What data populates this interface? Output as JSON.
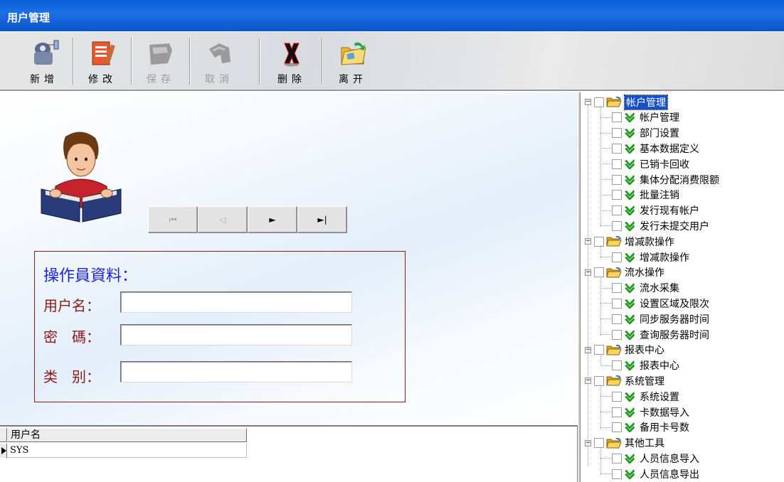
{
  "window": {
    "title": "用户管理"
  },
  "toolbar": {
    "buttons": [
      {
        "label": "新增",
        "icon": "new-user-icon",
        "enabled": true
      },
      {
        "label": "修改",
        "icon": "edit-form-icon",
        "enabled": true
      },
      {
        "label": "保存",
        "icon": "save-icon",
        "enabled": false
      },
      {
        "label": "取消",
        "icon": "undo-icon",
        "enabled": false
      },
      {
        "label": "删除",
        "icon": "delete-x-icon",
        "enabled": true
      },
      {
        "label": "离开",
        "icon": "exit-folder-icon",
        "enabled": true
      }
    ]
  },
  "navigator": {
    "first": "⏮",
    "prev": "◁",
    "next": "►",
    "last": "►|"
  },
  "form": {
    "title": "操作員資料：",
    "username_label": "用户名：",
    "password_label": "密　碼：",
    "category_label": "类　别：",
    "username_value": "",
    "password_value": "",
    "category_value": ""
  },
  "grid": {
    "columns": [
      "用户名"
    ],
    "rows": [
      [
        "SYS"
      ]
    ]
  },
  "tree": {
    "groups": [
      {
        "label": "帐户管理",
        "selected": true,
        "items": [
          "帐户管理",
          "部门设置",
          "基本数据定义",
          "已销卡回收",
          "集体分配消费限额",
          "批量注销",
          "发行现有帐户",
          "发行未提交用户"
        ]
      },
      {
        "label": "增减款操作",
        "selected": false,
        "items": [
          "增减款操作"
        ]
      },
      {
        "label": "流水操作",
        "selected": false,
        "items": [
          "流水采集",
          "设置区域及限次",
          "同步服务器时间",
          "查询服务器时间"
        ]
      },
      {
        "label": "报表中心",
        "selected": false,
        "items": [
          "报表中心"
        ]
      },
      {
        "label": "系统管理",
        "selected": false,
        "items": [
          "系统设置",
          "卡数据导入",
          "备用卡号数"
        ]
      },
      {
        "label": "其他工具",
        "selected": false,
        "items": [
          "人员信息导入",
          "人员信息导出"
        ]
      }
    ]
  },
  "colors": {
    "titlebar": "#0a5ed8",
    "form_border": "#8b1a1a",
    "form_title": "#1b24d6",
    "form_label": "#8b1a1a",
    "tree_selected": "#1450c8",
    "check_green": "#1f9a1f",
    "folder_yellow": "#f3c53a"
  }
}
